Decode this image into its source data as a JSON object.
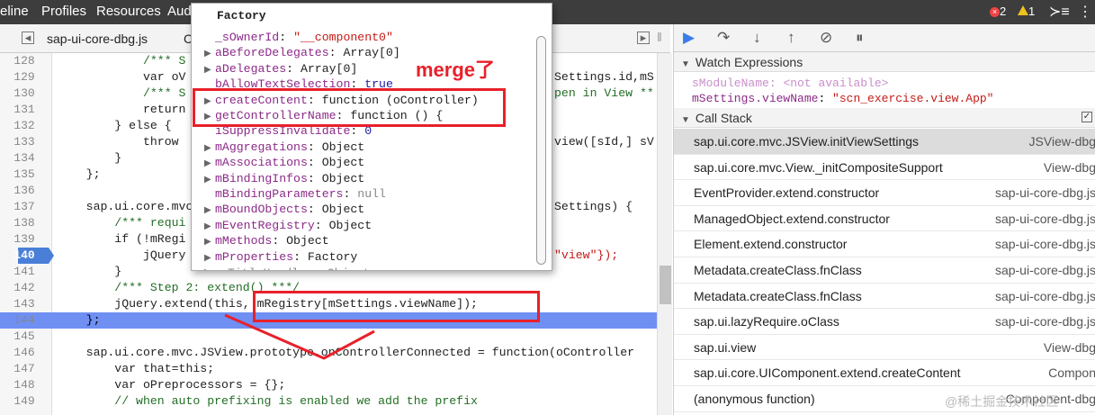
{
  "topbar": {
    "menu": [
      "eline",
      "Profiles",
      "Resources",
      "Aud"
    ],
    "error_count": "2",
    "warning_count": "1"
  },
  "tabbar": {
    "file_tab": "sap-ui-core-dbg.js",
    "extra": "C"
  },
  "editor": {
    "lines": [
      {
        "num": "128",
        "text": "            /*** S"
      },
      {
        "num": "129",
        "text": "            var oV"
      },
      {
        "num": "130",
        "text": "            /*** S"
      },
      {
        "num": "131",
        "text": "            return"
      },
      {
        "num": "132",
        "text": "        } else {"
      },
      {
        "num": "133",
        "text": "            throw"
      },
      {
        "num": "134",
        "text": "        }"
      },
      {
        "num": "135",
        "text": "    };"
      },
      {
        "num": "136",
        "text": ""
      },
      {
        "num": "137",
        "text": "    sap.ui.core.mvc"
      },
      {
        "num": "138",
        "text": "        /*** requi"
      },
      {
        "num": "139",
        "text": "        if (!mRegi"
      },
      {
        "num": "140",
        "text": "            jQuery"
      },
      {
        "num": "141",
        "text": "        }"
      },
      {
        "num": "142",
        "text": "        /*** Step 2: extend() ***/"
      },
      {
        "num": "143",
        "text": "        jQuery.extend(this, mRegistry[mSettings.viewName]);"
      },
      {
        "num": "144",
        "text": "    };"
      },
      {
        "num": "145",
        "text": ""
      },
      {
        "num": "146",
        "text": "    sap.ui.core.mvc.JSView.prototype.onControllerConnected = function(oController"
      },
      {
        "num": "147",
        "text": "        var that=this;"
      },
      {
        "num": "148",
        "text": "        var oPreprocessors = {};"
      },
      {
        "num": "149",
        "text": "        // when auto prefixing is enabled we add the prefix"
      }
    ],
    "right_fragments": {
      "r129": "Settings.id,mS",
      "r130": "pen in View **",
      "r133": "view([sId,] sV",
      "r137": "Settings) {",
      "r140": "\"view\"});"
    }
  },
  "popup": {
    "title": "Factory",
    "props": [
      {
        "arrow": "",
        "key": "_sOwnerId",
        "value": "\"__component0\"",
        "vclass": "pvs"
      },
      {
        "arrow": "▶",
        "key": "aBeforeDelegates",
        "value": "Array[0]",
        "vclass": "pv"
      },
      {
        "arrow": "▶",
        "key": "aDelegates",
        "value": "Array[0]",
        "vclass": "pv"
      },
      {
        "arrow": "",
        "key": "bAllowTextSelection",
        "value": "true",
        "vclass": "pvk"
      },
      {
        "arrow": "▶",
        "key": "createContent",
        "value": "function (oController)",
        "vclass": "pv"
      },
      {
        "arrow": "▶",
        "key": "getControllerName",
        "value": "function () {",
        "vclass": "pv"
      },
      {
        "arrow": "",
        "key": "iSuppressInvalidate",
        "value": "0",
        "vclass": "pvk"
      },
      {
        "arrow": "▶",
        "key": "mAggregations",
        "value": "Object",
        "vclass": "pv"
      },
      {
        "arrow": "▶",
        "key": "mAssociations",
        "value": "Object",
        "vclass": "pv"
      },
      {
        "arrow": "▶",
        "key": "mBindingInfos",
        "value": "Object",
        "vclass": "pv"
      },
      {
        "arrow": "",
        "key": "mBindingParameters",
        "value": "null",
        "vclass": "pvn"
      },
      {
        "arrow": "▶",
        "key": "mBoundObjects",
        "value": "Object",
        "vclass": "pv"
      },
      {
        "arrow": "▶",
        "key": "mEventRegistry",
        "value": "Object",
        "vclass": "pv"
      },
      {
        "arrow": "▶",
        "key": "mMethods",
        "value": "Object",
        "vclass": "pv"
      },
      {
        "arrow": "▶",
        "key": "mProperties",
        "value": "Factory",
        "vclass": "pv"
      }
    ],
    "annotation": "merge了"
  },
  "debugger": {
    "watch_title": "Watch Expressions",
    "watch": [
      {
        "key": "sModuleName",
        "value": "<not available>"
      },
      {
        "key": "mSettings.viewName",
        "value": "\"scn_exercise.view.App\""
      }
    ],
    "callstack_title": "Call Stack",
    "callstack": [
      {
        "fn": "sap.ui.core.mvc.JSView.initViewSettings",
        "file": "JSView-dbg"
      },
      {
        "fn": "sap.ui.core.mvc.View._initCompositeSupport",
        "file": "View-dbg"
      },
      {
        "fn": "EventProvider.extend.constructor",
        "file": "sap-ui-core-dbg.js"
      },
      {
        "fn": "ManagedObject.extend.constructor",
        "file": "sap-ui-core-dbg.js"
      },
      {
        "fn": "Element.extend.constructor",
        "file": "sap-ui-core-dbg.js"
      },
      {
        "fn": "Metadata.createClass.fnClass",
        "file": "sap-ui-core-dbg.js"
      },
      {
        "fn": "Metadata.createClass.fnClass",
        "file": "sap-ui-core-dbg.js"
      },
      {
        "fn": "sap.ui.lazyRequire.oClass",
        "file": "sap-ui-core-dbg.js"
      },
      {
        "fn": "sap.ui.view",
        "file": "View-dbg"
      },
      {
        "fn": "sap.ui.core.UIComponent.extend.createContent",
        "file": "Compon"
      },
      {
        "fn": "(anonymous function)",
        "file": "Component-dbg"
      }
    ]
  },
  "watermark": "@稀土掘金技术社区",
  "colors": {
    "accent": "#4a7fd8",
    "annotation": "#e8202a"
  }
}
